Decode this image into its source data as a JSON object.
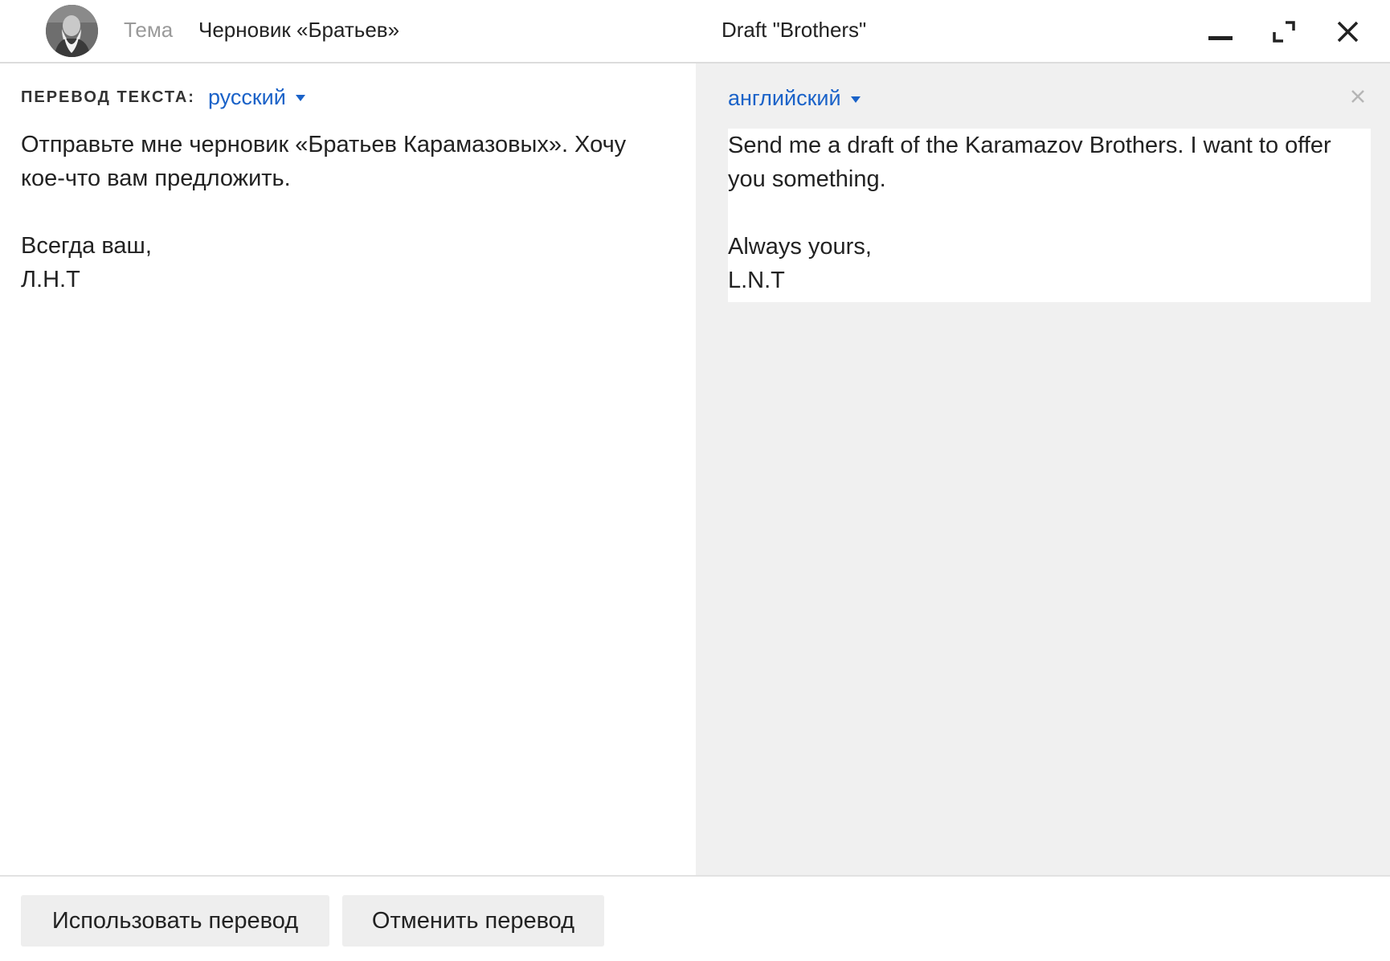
{
  "header": {
    "subject_label": "Тема",
    "subject_value": "Черновик «Братьев»",
    "draft_title": "Draft \"Brothers\""
  },
  "source": {
    "translate_label": "ПЕРЕВОД ТЕКСТА:",
    "language": "русский",
    "text": "Отправьте мне черновик «Братьев Карамазовых». Хочу\nкое-что вам предложить.\n\nВсегда ваш,\nЛ.Н.Т"
  },
  "target": {
    "language": "английский",
    "text": "Send me a draft of the Karamazov Brothers. I want to offer\nyou something.\n\nAlways yours,\nL.N.T"
  },
  "footer": {
    "use_translation": "Использовать перевод",
    "cancel_translation": "Отменить перевод"
  },
  "colors": {
    "accent": "#1a62c8",
    "panel_bg": "#f0f0f0",
    "button_bg": "#eeeeee"
  },
  "icons": {
    "window_controls": [
      "minimize-icon",
      "expand-icon",
      "close-icon"
    ],
    "panel_close": "close-icon"
  }
}
